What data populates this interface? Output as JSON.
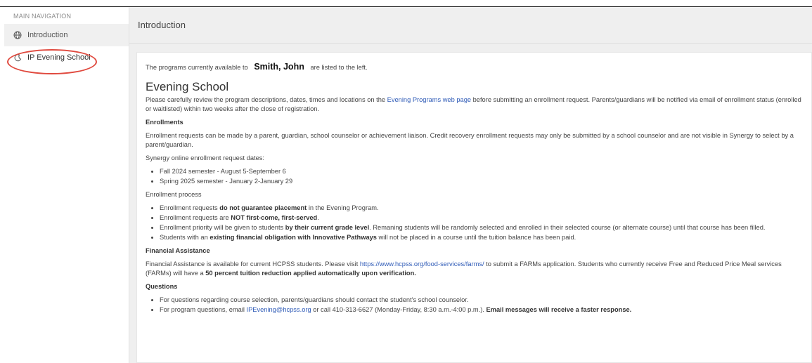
{
  "sidebar": {
    "header": "MAIN NAVIGATION",
    "items": [
      {
        "label": "Introduction",
        "icon": "globe-icon"
      },
      {
        "label": "IP Evening School",
        "icon": "moon-icon"
      }
    ]
  },
  "main": {
    "header_title": "Introduction",
    "intro": {
      "prefix": "The programs currently available to",
      "student_name": "Smith, John",
      "suffix": "are listed to the left."
    },
    "title": "Evening School",
    "review": {
      "text1": "Please carefully review the program descriptions, dates, times and locations on the ",
      "link": "Evening Programs web page",
      "text2": " before submitting an enrollment request. Parents/guardians will be notified via email of enrollment status (enrolled or waitlisted) within two weeks after the close of registration."
    },
    "enrollments_heading": "Enrollments",
    "enrollments_text": "Enrollment requests can be made by a parent, guardian, school counselor or achievement liaison. Credit recovery enrollment requests may only be submitted by a school counselor and are not visible in Synergy to select by a parent/guardian.",
    "dates_label": "Synergy online enrollment request dates:",
    "dates": [
      "Fall 2024 semester - August 5-September 6",
      "Spring 2025 semester - January 2-January 29"
    ],
    "process_label": "Enrollment process",
    "process": [
      {
        "pre": "Enrollment requests ",
        "bold": "do not guarantee placement",
        "post": " in the Evening Program."
      },
      {
        "pre": "Enrollment requests are ",
        "bold": "NOT first-come, first-served",
        "post": "."
      },
      {
        "pre": "Enrollment priority will be given to students ",
        "bold": "by their current grade level",
        "post": ". Remaning students will be randomly selected and enrolled in their selected course (or alternate course) until that course has been filled."
      },
      {
        "pre": "Students with an ",
        "bold": "existing financial obligation with Innovative Pathways",
        "post": " will not be placed in a course until the tuition balance has been paid."
      }
    ],
    "financial_heading": "Financial Assistance",
    "financial": {
      "text1": "Financial Assistance is available for current HCPSS students. Please visit ",
      "link": "https://www.hcpss.org/food-services/farms/",
      "text2": " to submit a FARMs application. Students who currently receive Free and Reduced Price Meal services (FARMs) will have a ",
      "bold": "50 percent tuition reduction applied automatically upon verification."
    },
    "questions_heading": "Questions",
    "questions": {
      "item1": "For questions regarding course selection, parents/guardians should contact the student's school counselor.",
      "item2_pre": "For program questions, email ",
      "item2_link": "IPEvening@hcpss.org",
      "item2_mid": " or call 410-313-6627 (Monday-Friday, 8:30 a.m.-4:00 p.m.). ",
      "item2_bold": "Email messages will receive a faster response."
    }
  },
  "colors": {
    "link": "#2f5bb7",
    "highlight_ring": "#e04a3f",
    "active_nav_bg": "#f0f0f0"
  }
}
